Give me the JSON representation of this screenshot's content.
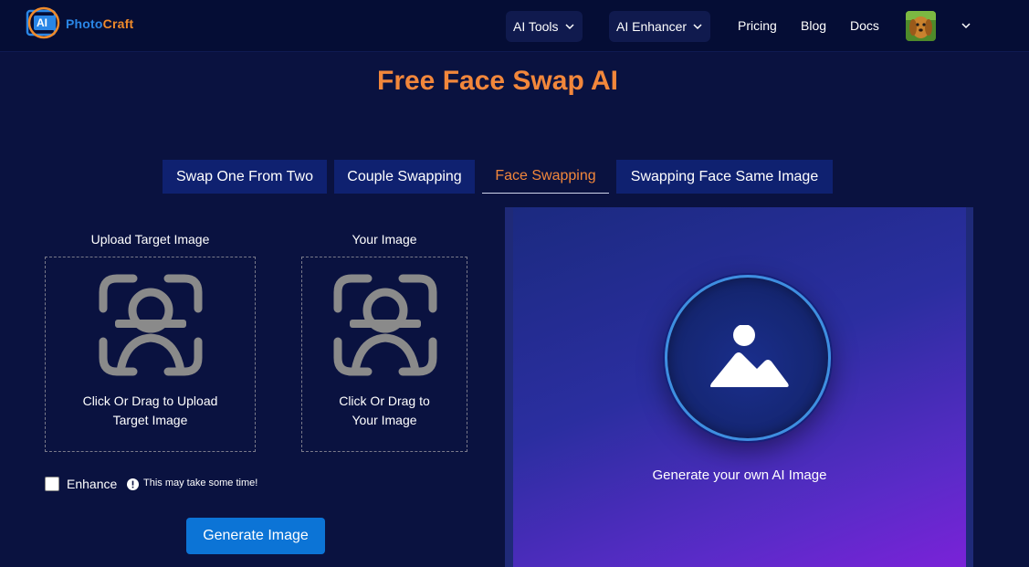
{
  "header": {
    "logo_ai": "AI",
    "logo_part1": "Photo",
    "logo_part2": "Craft",
    "nav": [
      {
        "label": "AI Tools"
      },
      {
        "label": "AI Enhancer"
      },
      {
        "label": "Pricing"
      },
      {
        "label": "Blog"
      },
      {
        "label": "Docs"
      }
    ],
    "avatar_icon": "dog-avatar"
  },
  "page_title": "Free Face Swap AI",
  "tabs": [
    {
      "label": "Swap One From Two",
      "active": false
    },
    {
      "label": "Couple Swapping",
      "active": false
    },
    {
      "label": "Face Swapping",
      "active": true
    },
    {
      "label": "Swapping Face Same Image",
      "active": false
    }
  ],
  "upload": {
    "target": {
      "label": "Upload Target Image",
      "text_line1": "Click Or Drag to Upload",
      "text_line2": "Target Image",
      "icon": "face-scan-icon"
    },
    "yours": {
      "label": "Your Image",
      "text_line1": "Click Or Drag to",
      "text_line2": "Your Image",
      "icon": "face-scan-icon"
    }
  },
  "options": {
    "enhance_label": "Enhance",
    "enhance_checked": false,
    "warning": "This may take some time!"
  },
  "generate_button": "Generate Image",
  "preview": {
    "caption": "Generate your own AI Image",
    "icon": "image-icon"
  },
  "colors": {
    "accent": "#f2873b",
    "primary": "#0c74d6",
    "background": "#0a1240",
    "tab_bg": "#0f2170"
  }
}
